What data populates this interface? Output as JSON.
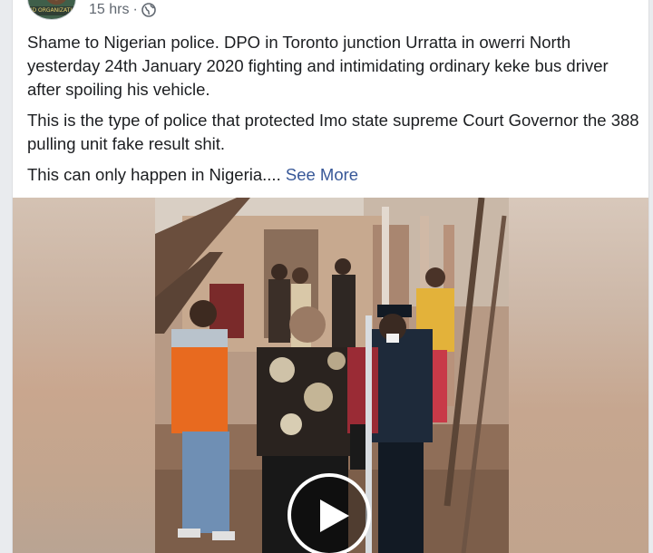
{
  "post": {
    "timestamp": "15 hrs",
    "separator": "·",
    "privacy_icon": "globe-icon",
    "avatar_text": "ND ORGANIZATION",
    "paragraphs": [
      "Shame to Nigerian police. DPO in Toronto junction Urratta in owerri North yesterday 24th January 2020 fighting and intimidating ordinary keke bus driver after spoiling his vehicle.",
      "This is the type of police that protected Imo state supreme Court Governor the 388 pulling unit fake result shit.",
      "This can only happen in Nigeria.... "
    ],
    "see_more": "See More"
  },
  "video": {
    "play_icon": "play-icon"
  },
  "colors": {
    "link": "#385898",
    "text": "#1c1e21",
    "meta": "#606770",
    "background": "#e9ebee"
  }
}
